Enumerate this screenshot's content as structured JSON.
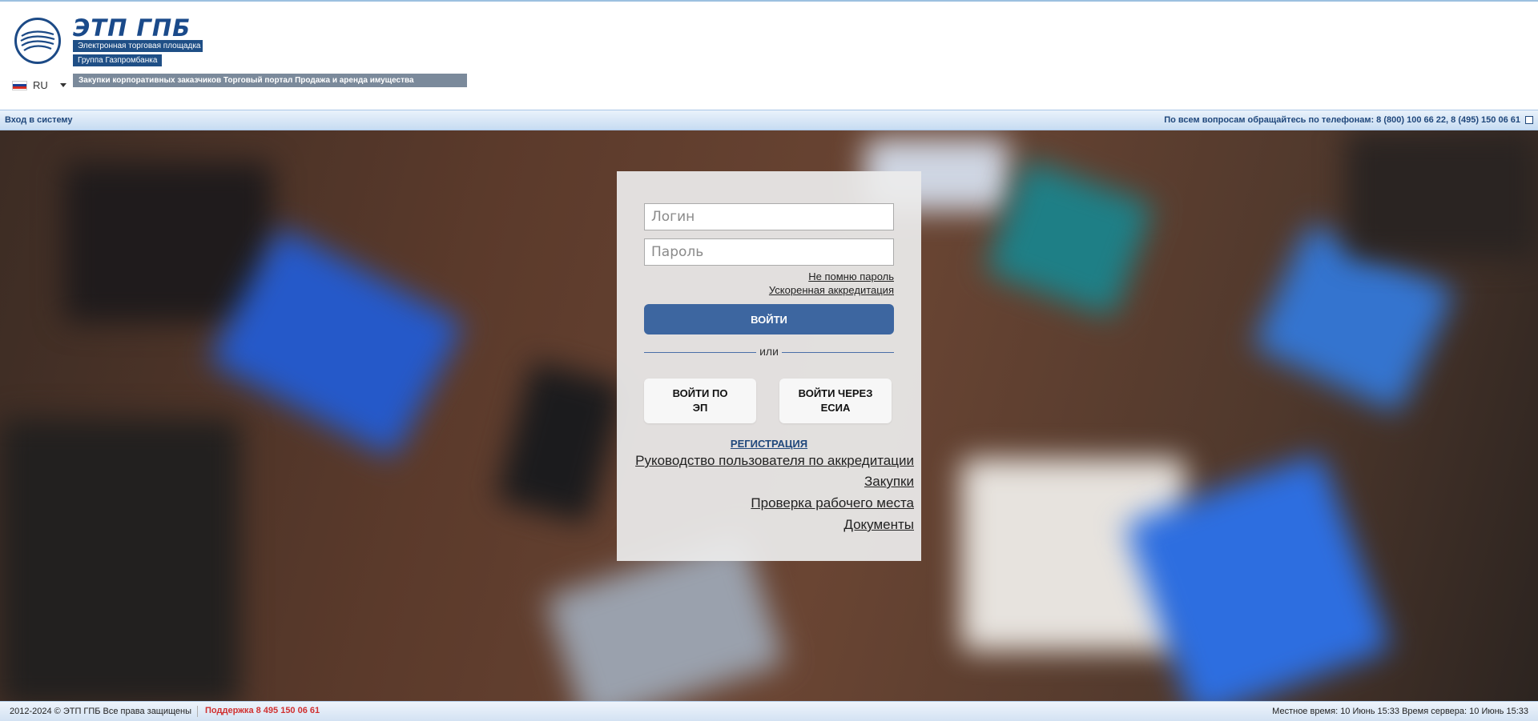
{
  "header": {
    "brand_title": "ЭТП ГПБ",
    "tag_line_1": "Электронная торговая площадка",
    "tag_line_2": "Группа Газпромбанка",
    "portal_bar": "Закупки корпоративных заказчиков Торговый портал Продажа и аренда имущества",
    "language": "RU",
    "flag_icon": "russia-flag-icon"
  },
  "navbar": {
    "login_link": "Вход в систему",
    "phones": "По всем вопросам обращайтесь по телефонам: 8 (800) 100 66 22, 8 (495) 150 06 61"
  },
  "login_form": {
    "login_placeholder": "Логин",
    "password_placeholder": "Пароль",
    "forgot_password": "Не помню пароль",
    "fast_accreditation": "Ускоренная аккредитация",
    "login_button": "ВОЙТИ",
    "or_text": "или",
    "ep_button": "ВОЙТИ ПО\nЭП",
    "esia_button": "ВОЙТИ ЧЕРЕЗ\nЕСИА",
    "registration": "РЕГИСТРАЦИЯ",
    "links": [
      "Руководство пользователя по аккредитации",
      "Закупки",
      "Проверка рабочего места",
      "Документы"
    ]
  },
  "footer": {
    "copyright": "2012-2024 © ЭТП ГПБ Все права защищены",
    "support": "Поддержка 8 495 150 06 61",
    "time": "Местное время: 10 Июнь 15:33 Время сервера: 10 Июнь 15:33"
  },
  "colors": {
    "brand_blue": "#1f4f86",
    "button_blue": "#3d66a0",
    "support_red": "#d03030"
  }
}
